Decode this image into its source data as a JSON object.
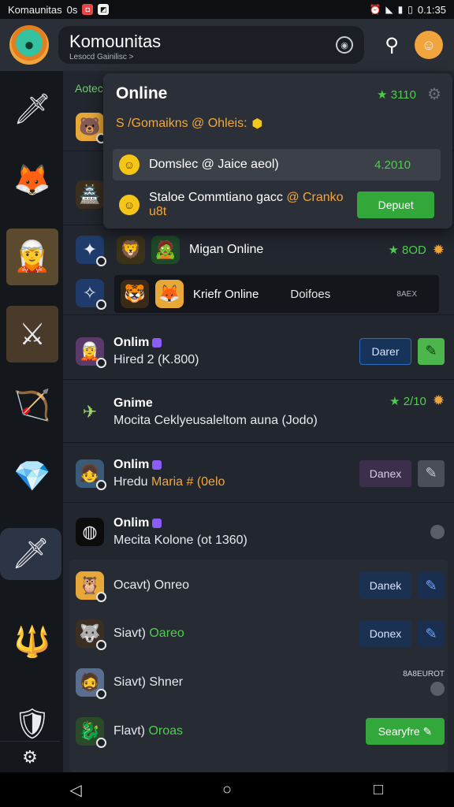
{
  "status_bar": {
    "app_name": "Komaunitas",
    "app_suffix": "0s",
    "time": "0.1:35",
    "icons": [
      "alarm-icon",
      "wifi-icon",
      "signal-icon",
      "battery-icon"
    ]
  },
  "header": {
    "title": "Komounitas",
    "subtitle": "Lesocd Gainilisc >",
    "logo_icon": "community-logo-icon"
  },
  "rail": {
    "items": [
      {
        "name": "game-1",
        "glyph": "🗡"
      },
      {
        "name": "game-2",
        "glyph": "🦊"
      },
      {
        "name": "game-3",
        "glyph": "🧝"
      },
      {
        "name": "game-4",
        "glyph": "⚔"
      },
      {
        "name": "game-5",
        "glyph": "🏹"
      },
      {
        "name": "game-6",
        "glyph": "💎"
      },
      {
        "name": "game-7",
        "glyph": "🗡"
      },
      {
        "name": "game-8",
        "glyph": "🔱"
      },
      {
        "name": "game-9",
        "glyph": "🛡"
      }
    ],
    "bottom_icon_glyph": "☊"
  },
  "main": {
    "section_label": "Aotec",
    "rows": [
      {
        "title": "Migan Online",
        "score": "★ 8OD"
      },
      {
        "box_label": "Kriefr Online",
        "box_label2": "Doifoes",
        "box_label3": "8AEX"
      },
      {
        "title": "Onlim",
        "sub": "Hired 2 (K.800)",
        "btn": "Darer"
      },
      {
        "title": "Gnime",
        "sub": "Mocita Ceklyeusaleltom auna (Jodo)",
        "score": "★ 2/10"
      },
      {
        "title": "Onlim",
        "sub_prefix": "Hredu ",
        "sub_accent": "Maria # (0elo",
        "btn": "Danex"
      },
      {
        "title": "Onlim",
        "sub": "Mecita Kolone (ot 1360)"
      },
      {
        "title": "Ocavt) Onreo",
        "btn": "Danek"
      },
      {
        "title_prefix": "Siavt) ",
        "title_accent": "Oareo",
        "btn": "Donex"
      },
      {
        "title": "Siavt) Shner",
        "corner": "8A8EUROT"
      },
      {
        "title_prefix": "Flavt) ",
        "title_accent": "Oroas",
        "btn": "Searyfre"
      }
    ]
  },
  "popover": {
    "title": "Online",
    "score": "★ 3110",
    "subtitle": "S /Gomaikns @ Ohleis:",
    "rows": [
      {
        "text": "Domslec @ Jaice aeol)",
        "num": "4.2010"
      },
      {
        "text_prefix": "Staloe Commtiano gacc ",
        "text_accent": "@ Cranko u8t",
        "btn": "Depuet"
      }
    ]
  },
  "navbar": {
    "back": "◁",
    "home": "○",
    "recents": "□"
  },
  "colors": {
    "accent_green": "#4cd04c",
    "accent_orange": "#f4a63a",
    "button_blue": "#163459"
  }
}
